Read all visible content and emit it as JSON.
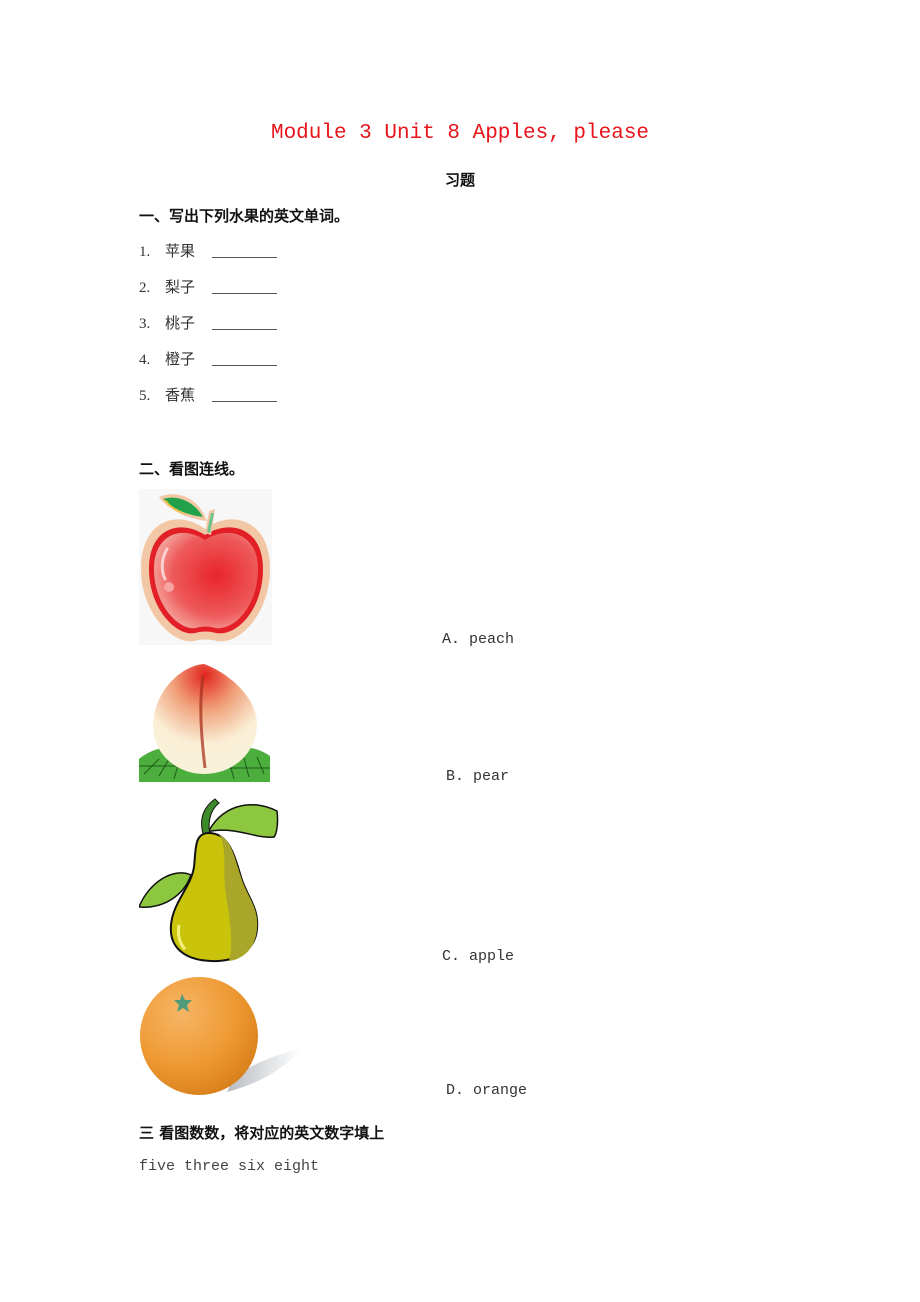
{
  "document": {
    "title": "Module 3 Unit 8 Apples, please",
    "subtitle": "习题",
    "title_color": "#e8141b"
  },
  "section1": {
    "heading": "一、写出下列水果的英文单词。",
    "items": [
      {
        "num": "1.",
        "text": "苹果"
      },
      {
        "num": "2.",
        "text": "梨子"
      },
      {
        "num": "3.",
        "text": "桃子"
      },
      {
        "num": "4.",
        "text": "橙子"
      },
      {
        "num": "5.",
        "text": "香蕉"
      }
    ]
  },
  "section2": {
    "heading": "二、看图连线。",
    "images": [
      {
        "icon": "apple-image"
      },
      {
        "icon": "peach-image"
      },
      {
        "icon": "pear-image"
      },
      {
        "icon": "orange-image"
      }
    ],
    "options": [
      {
        "label": "A.  peach"
      },
      {
        "label": "B.  pear"
      },
      {
        "label": "C.  apple"
      },
      {
        "label": "D.  orange"
      }
    ]
  },
  "section3": {
    "heading": "三 看图数数，将对应的英文数字填上",
    "words": "five three six eight"
  }
}
